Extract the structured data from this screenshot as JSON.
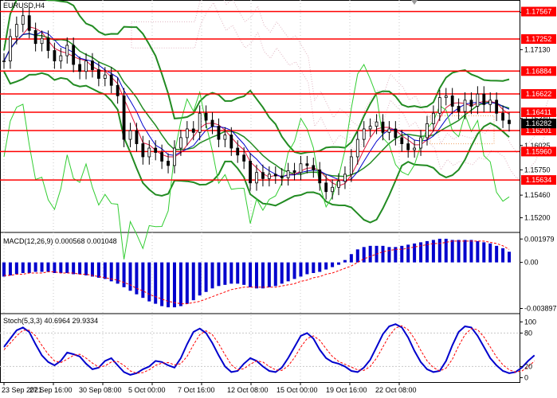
{
  "chart_data": {
    "type": "line",
    "title": "EURUSD,H4",
    "instrument": "EURUSD",
    "timeframe": "H4",
    "x_labels": [
      "23 Sep 2021",
      "27 Sep 16:00",
      "30 Sep 08:00",
      "5 Oct 00:00",
      "7 Oct 16:00",
      "12 Oct 08:00",
      "15 Oct 00:00",
      "19 Oct 16:00",
      "22 Oct 08:00"
    ],
    "colors": {
      "grid": "#c8c8c8",
      "level_line": "#ff0000",
      "upper_band": "#228b22",
      "ma_blue": "#0000cd",
      "ma_red": "#dc143c",
      "osc_lime": "#32cd32",
      "cloud_pink": "#d8a0b0",
      "cloud_orange": "#f0a060",
      "macd_hist": "#0000cd",
      "macd_signal": "#ff0000",
      "stoch_main": "#0000cd",
      "stoch_signal": "#ff0000",
      "label_bg_red": "#ff0000",
      "label_bg_dark": "#000000"
    },
    "price_axis": {
      "ylim": [
        1.1505,
        1.177
      ],
      "ticks": [
        1.1756,
        1.1713,
        1.1634,
        1.1603,
        1.1575,
        1.1546,
        1.152
      ],
      "tick_labels": [
        "1.17567",
        "1.17130",
        "1.16340",
        "1.16025",
        "1.15750",
        "1.15460",
        "1.15200"
      ]
    },
    "levels": [
      {
        "value": 1.17567,
        "label": "1.17567"
      },
      {
        "value": 1.17252,
        "label": "1.17252"
      },
      {
        "value": 1.16884,
        "label": "1.16884"
      },
      {
        "value": 1.16622,
        "label": "1.16622"
      },
      {
        "value": 1.16411,
        "label": "1.16411"
      },
      {
        "value": 1.16201,
        "label": "1.16201"
      },
      {
        "value": 1.1596,
        "label": "1.15960"
      },
      {
        "value": 1.15634,
        "label": "1.15634"
      }
    ],
    "current_price": {
      "value": 1.16282,
      "label": "1.16282"
    },
    "candles_close": [
      1.17,
      1.1728,
      1.1742,
      1.1752,
      1.1735,
      1.172,
      1.1726,
      1.1712,
      1.17,
      1.1706,
      1.1718,
      1.1696,
      1.1688,
      1.17,
      1.169,
      1.168,
      1.1684,
      1.1672,
      1.166,
      1.161,
      1.162,
      1.1605,
      1.159,
      1.16,
      1.1595,
      1.1585,
      1.158,
      1.16,
      1.1612,
      1.1622,
      1.1618,
      1.164,
      1.1632,
      1.1625,
      1.161,
      1.1615,
      1.16,
      1.1592,
      1.1585,
      1.156,
      1.1572,
      1.1565,
      1.157,
      1.1568,
      1.1566,
      1.1574,
      1.1572,
      1.1582,
      1.158,
      1.1575,
      1.156,
      1.155,
      1.1555,
      1.1562,
      1.157,
      1.159,
      1.161,
      1.1622,
      1.1625,
      1.163,
      1.1618,
      1.1622,
      1.1612,
      1.1605,
      1.1598,
      1.16,
      1.1612,
      1.1628,
      1.164,
      1.1658,
      1.166,
      1.1648,
      1.1642,
      1.1655,
      1.1648,
      1.1662,
      1.165,
      1.1655,
      1.164,
      1.1632,
      1.1628
    ],
    "macd": {
      "label": "MACD(12,26,9) 0.000568 0.001048",
      "ylim": [
        -0.0042,
        0.0024
      ],
      "ticks": [
        0.001979,
        0.0,
        -0.003897
      ],
      "tick_labels": [
        "0.001979",
        "0.00",
        "-0.003897"
      ],
      "histogram": [
        -0.0012,
        -0.0011,
        -0.001,
        -0.0009,
        -0.0009,
        -0.0008,
        -0.0008,
        -0.0008,
        -0.0009,
        -0.0009,
        -0.0009,
        -0.001,
        -0.001,
        -0.0011,
        -0.0012,
        -0.0013,
        -0.0014,
        -0.0016,
        -0.0018,
        -0.0021,
        -0.0024,
        -0.0027,
        -0.003,
        -0.0033,
        -0.0035,
        -0.0037,
        -0.0038,
        -0.0038,
        -0.0037,
        -0.0035,
        -0.0032,
        -0.0028,
        -0.0025,
        -0.0022,
        -0.002,
        -0.0019,
        -0.0018,
        -0.0018,
        -0.0019,
        -0.0021,
        -0.0022,
        -0.0022,
        -0.0021,
        -0.002,
        -0.0018,
        -0.0016,
        -0.0014,
        -0.0012,
        -0.001,
        -0.0009,
        -0.0008,
        -0.0006,
        -0.0004,
        -0.0002,
        0.0002,
        0.0007,
        0.0011,
        0.0013,
        0.0014,
        0.0014,
        0.0014,
        0.0013,
        0.0013,
        0.0014,
        0.0015,
        0.0016,
        0.0017,
        0.0018,
        0.0019,
        0.002,
        0.002,
        0.0019,
        0.0019,
        0.0019,
        0.0019,
        0.0018,
        0.0017,
        0.0016,
        0.0014,
        0.0012,
        0.0009
      ],
      "signal": [
        -0.0011,
        -0.0011,
        -0.001,
        -0.001,
        -0.0009,
        -0.0009,
        -0.0009,
        -0.0008,
        -0.0008,
        -0.0009,
        -0.0009,
        -0.0009,
        -0.001,
        -0.001,
        -0.0011,
        -0.0012,
        -0.0013,
        -0.0014,
        -0.0015,
        -0.0017,
        -0.0019,
        -0.0022,
        -0.0024,
        -0.0027,
        -0.0029,
        -0.0031,
        -0.0033,
        -0.0034,
        -0.0035,
        -0.0035,
        -0.0034,
        -0.0033,
        -0.0031,
        -0.0029,
        -0.0027,
        -0.0025,
        -0.0023,
        -0.0022,
        -0.0021,
        -0.0021,
        -0.0021,
        -0.0021,
        -0.0021,
        -0.0021,
        -0.002,
        -0.0019,
        -0.0018,
        -0.0016,
        -0.0015,
        -0.0013,
        -0.0012,
        -0.001,
        -0.0009,
        -0.0007,
        -0.0005,
        -0.0003,
        0.0,
        0.0003,
        0.0005,
        0.0007,
        0.0009,
        0.001,
        0.0011,
        0.0011,
        0.0012,
        0.0013,
        0.0014,
        0.0015,
        0.0016,
        0.0016,
        0.0017,
        0.0018,
        0.0018,
        0.0018,
        0.0018,
        0.0018,
        0.0018,
        0.0017,
        0.0016,
        0.0014,
        0.0011
      ]
    },
    "stoch": {
      "label": "Stoch(5,3,3) 40.6964 29.9334",
      "ylim": [
        -8,
        112
      ],
      "ticks": [
        100,
        80,
        20,
        0
      ],
      "tick_labels": [
        "100",
        "80",
        "20",
        "0"
      ],
      "main": [
        55,
        70,
        85,
        90,
        82,
        60,
        40,
        28,
        22,
        30,
        45,
        42,
        38,
        25,
        15,
        18,
        30,
        35,
        22,
        10,
        5,
        8,
        15,
        20,
        30,
        28,
        22,
        18,
        35,
        60,
        82,
        88,
        80,
        62,
        40,
        20,
        10,
        12,
        25,
        35,
        30,
        20,
        12,
        10,
        18,
        35,
        55,
        75,
        80,
        70,
        50,
        35,
        28,
        25,
        20,
        12,
        10,
        18,
        32,
        55,
        78,
        92,
        96,
        90,
        72,
        48,
        28,
        15,
        10,
        12,
        30,
        58,
        82,
        92,
        90,
        75,
        55,
        35,
        22,
        12,
        8,
        10,
        18,
        30,
        40
      ],
      "signal": [
        50,
        62,
        75,
        85,
        85,
        75,
        58,
        42,
        30,
        27,
        33,
        40,
        42,
        35,
        26,
        19,
        21,
        28,
        29,
        22,
        12,
        8,
        9,
        14,
        22,
        26,
        27,
        23,
        25,
        38,
        59,
        77,
        84,
        77,
        61,
        41,
        23,
        14,
        16,
        24,
        30,
        28,
        20,
        14,
        13,
        21,
        36,
        55,
        70,
        75,
        67,
        52,
        38,
        29,
        24,
        19,
        14,
        13,
        20,
        35,
        55,
        75,
        89,
        93,
        86,
        70,
        49,
        30,
        18,
        12,
        17,
        33,
        57,
        77,
        88,
        86,
        73,
        55,
        37,
        23,
        14,
        10,
        12,
        19,
        30
      ]
    }
  }
}
